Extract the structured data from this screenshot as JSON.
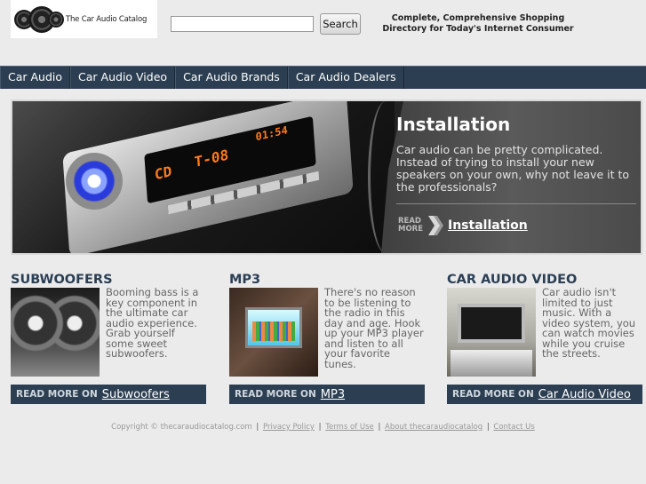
{
  "logo": {
    "text": "The Car Audio Catalog"
  },
  "search": {
    "value": "",
    "button_label": "Search"
  },
  "tagline": {
    "line1": "Complete, Comprehensive Shopping",
    "line2": "Directory for Today's Internet Consumer"
  },
  "nav": {
    "items": [
      {
        "label": "Car Audio"
      },
      {
        "label": "Car Audio Video"
      },
      {
        "label": "Car Audio Brands"
      },
      {
        "label": "Car Audio Dealers"
      }
    ]
  },
  "hero": {
    "title": "Installation",
    "text": "Car audio can be pretty complicated. Instead of trying to install your new speakers on your own, why not leave it to the professionals?",
    "read_line1": "READ",
    "read_line2": "MORE",
    "link": "Installation",
    "display_cd": "CD",
    "display_track": "T-08",
    "display_time": "01:54"
  },
  "columns": [
    {
      "title": "SUBWOOFERS",
      "text": "Booming bass is a key component in the ultimate car audio experience. Grab yourself some sweet subwoofers.",
      "read_more": "READ MORE ON",
      "link": "Subwoofers"
    },
    {
      "title": "MP3",
      "text": "There's no reason to be listening to the radio in this day and age. Hook up your MP3 player and listen to all your favorite tunes.",
      "read_more": "READ MORE ON",
      "link": "MP3"
    },
    {
      "title": "CAR AUDIO VIDEO",
      "text": "Car audio isn't limited to just music. With a video system, you can watch movies while you cruise the streets.",
      "read_more": "READ MORE ON",
      "link": "Car Audio Video"
    }
  ],
  "footer": {
    "copyright": "Copyright © thecaraudiocatalog.com",
    "privacy": "Privacy Policy",
    "terms": "Terms of Use",
    "about": "About thecaraudiocatalog",
    "contact": "Contact Us"
  }
}
